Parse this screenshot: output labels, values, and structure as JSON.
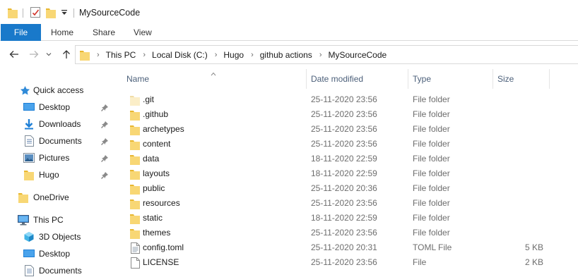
{
  "window": {
    "title": "MySourceCode"
  },
  "ribbon": {
    "tabs": [
      "File",
      "Home",
      "Share",
      "View"
    ]
  },
  "address": {
    "breadcrumbs": [
      "This PC",
      "Local Disk (C:)",
      "Hugo",
      "github actions",
      "MySourceCode"
    ]
  },
  "icons": {
    "back": "back-arrow-icon",
    "forward": "forward-arrow-icon",
    "recent": "chevron-down-icon",
    "up": "up-arrow-icon"
  },
  "colors": {
    "accent": "#1979ca",
    "folder": "#f8d775",
    "folder_dark": "#e8b730"
  },
  "nav": {
    "quick_access": "Quick access",
    "items": [
      {
        "label": "Desktop",
        "icon": "desktop-icon",
        "pinned": true
      },
      {
        "label": "Downloads",
        "icon": "downloads-icon",
        "pinned": true
      },
      {
        "label": "Documents",
        "icon": "documents-icon",
        "pinned": true
      },
      {
        "label": "Pictures",
        "icon": "pictures-icon",
        "pinned": true
      },
      {
        "label": "Hugo",
        "icon": "folder-icon",
        "pinned": true
      }
    ],
    "onedrive": "OneDrive",
    "this_pc": "This PC",
    "pc_items": [
      {
        "label": "3D Objects",
        "icon": "3d-objects-icon"
      },
      {
        "label": "Desktop",
        "icon": "desktop-icon"
      },
      {
        "label": "Documents",
        "icon": "documents-icon"
      }
    ]
  },
  "columns": {
    "name": "Name",
    "date": "Date modified",
    "type": "Type",
    "size": "Size"
  },
  "files": [
    {
      "name": ".git",
      "date": "25-11-2020 23:56",
      "type": "File folder",
      "size": "",
      "icon": "folder-light-icon"
    },
    {
      "name": ".github",
      "date": "25-11-2020 23:56",
      "type": "File folder",
      "size": "",
      "icon": "folder-icon"
    },
    {
      "name": "archetypes",
      "date": "25-11-2020 23:56",
      "type": "File folder",
      "size": "",
      "icon": "folder-icon"
    },
    {
      "name": "content",
      "date": "25-11-2020 23:56",
      "type": "File folder",
      "size": "",
      "icon": "folder-icon"
    },
    {
      "name": "data",
      "date": "18-11-2020 22:59",
      "type": "File folder",
      "size": "",
      "icon": "folder-icon"
    },
    {
      "name": "layouts",
      "date": "18-11-2020 22:59",
      "type": "File folder",
      "size": "",
      "icon": "folder-icon"
    },
    {
      "name": "public",
      "date": "25-11-2020 20:36",
      "type": "File folder",
      "size": "",
      "icon": "folder-icon"
    },
    {
      "name": "resources",
      "date": "25-11-2020 23:56",
      "type": "File folder",
      "size": "",
      "icon": "folder-icon"
    },
    {
      "name": "static",
      "date": "18-11-2020 22:59",
      "type": "File folder",
      "size": "",
      "icon": "folder-icon"
    },
    {
      "name": "themes",
      "date": "25-11-2020 23:56",
      "type": "File folder",
      "size": "",
      "icon": "folder-icon"
    },
    {
      "name": "config.toml",
      "date": "25-11-2020 20:31",
      "type": "TOML File",
      "size": "5 KB",
      "icon": "toml-file-icon"
    },
    {
      "name": "LICENSE",
      "date": "25-11-2020 23:56",
      "type": "File",
      "size": "2 KB",
      "icon": "file-icon"
    }
  ]
}
